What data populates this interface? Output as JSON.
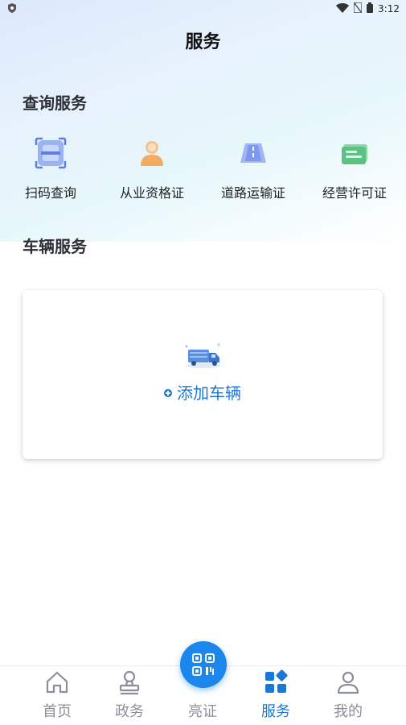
{
  "status_bar": {
    "time": "3:12"
  },
  "header": {
    "title": "服务"
  },
  "query_section": {
    "title": "查询服务",
    "items": [
      {
        "label": "扫码查询",
        "icon": "scan-frame-icon"
      },
      {
        "label": "从业资格证",
        "icon": "person-icon"
      },
      {
        "label": "道路运输证",
        "icon": "road-icon"
      },
      {
        "label": "经营许可证",
        "icon": "license-card-icon"
      }
    ]
  },
  "vehicle_section": {
    "title": "车辆服务",
    "add_label": "添加车辆",
    "icon": "truck-icon"
  },
  "tabbar": {
    "items": [
      {
        "label": "首页",
        "icon": "home-icon"
      },
      {
        "label": "政务",
        "icon": "stamp-icon"
      },
      {
        "label": "亮证",
        "icon": "qr-code-icon"
      },
      {
        "label": "服务",
        "icon": "grid-services-icon",
        "active": true
      },
      {
        "label": "我的",
        "icon": "user-icon"
      }
    ]
  },
  "colors": {
    "accent": "#1a78d6",
    "center_button": "#1b86ec",
    "inactive": "#8a8f98"
  }
}
